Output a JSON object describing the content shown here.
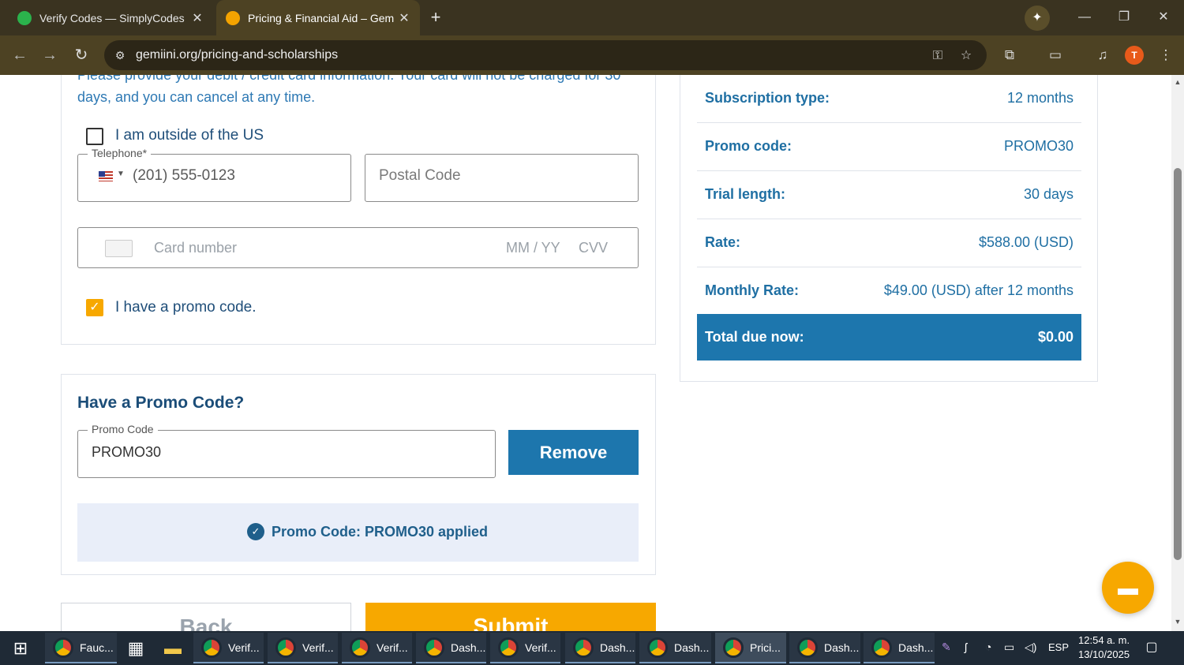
{
  "browser": {
    "tabs": [
      {
        "title": "Verify Codes — SimplyCodes",
        "active": false
      },
      {
        "title": "Pricing & Financial Aid – Gemini",
        "active": true
      }
    ],
    "new_tab": "+",
    "url": "gemiini.org/pricing-and-scholarships",
    "profile_initial": "T"
  },
  "form": {
    "intro_line1": "Please provide your debit / credit card information. Your card will not be charged for 30",
    "intro_line2": "days, and you can cancel at any time.",
    "outside_us_label": "I am outside of the US",
    "outside_us_checked": false,
    "telephone_legend": "Telephone*",
    "telephone_value": "(201) 555-0123",
    "postal_placeholder": "Postal Code",
    "card_number_placeholder": "Card number",
    "expiry_placeholder": "MM / YY",
    "cvv_placeholder": "CVV",
    "promo_checkbox_label": "I have a promo code.",
    "promo_checkbox_checked": true
  },
  "promo": {
    "heading": "Have a Promo Code?",
    "field_legend": "Promo Code",
    "field_value": "PROMO30",
    "remove_label": "Remove",
    "applied_text": "Promo Code: PROMO30 applied"
  },
  "actions": {
    "back_label": "Back",
    "submit_label": "Submit"
  },
  "summary": {
    "rows": [
      {
        "label": "Subscription type:",
        "value": "12 months"
      },
      {
        "label": "Promo code:",
        "value": "PROMO30"
      },
      {
        "label": "Trial length:",
        "value": "30 days"
      },
      {
        "label": "Rate:",
        "value": "$588.00 (USD)"
      },
      {
        "label": "Monthly Rate:",
        "value": "$49.00 (USD) after 12 months"
      }
    ],
    "total_label": "Total due now:",
    "total_value": "$0.00"
  },
  "taskbar": {
    "apps": [
      {
        "label": "Fauc..."
      },
      {
        "label": "Verif..."
      },
      {
        "label": "Verif..."
      },
      {
        "label": "Verif..."
      },
      {
        "label": "Dash..."
      },
      {
        "label": "Verif..."
      },
      {
        "label": "Dash..."
      },
      {
        "label": "Dash..."
      },
      {
        "label": "Prici..."
      },
      {
        "label": "Dash..."
      },
      {
        "label": "Dash..."
      }
    ],
    "language": "ESP",
    "time": "12:54 a. m.",
    "date": "13/10/2025"
  },
  "colors": {
    "accent_orange": "#f7a800",
    "primary_blue": "#1d76ad",
    "text_blue": "#1f6fa3"
  }
}
